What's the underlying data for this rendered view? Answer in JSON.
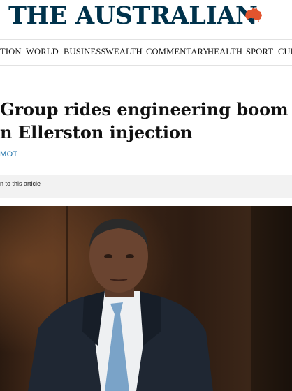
{
  "masthead": {
    "logo_text": "THE AUSTRALIAN",
    "logo_color": "#00324b",
    "map_color": "#e2542e"
  },
  "nav": {
    "items": [
      "TION",
      "WORLD",
      "BUSINESS",
      "WEALTH",
      "COMMENTARY",
      "HEALTH",
      "SPORT",
      "CUL"
    ]
  },
  "article": {
    "headline_line1": "Group rides engineering boom with",
    "headline_line2": "n Ellerston injection",
    "byline": "MOT",
    "listen_text": "n to this article"
  },
  "photo": {
    "icon": "portrait-photo"
  }
}
